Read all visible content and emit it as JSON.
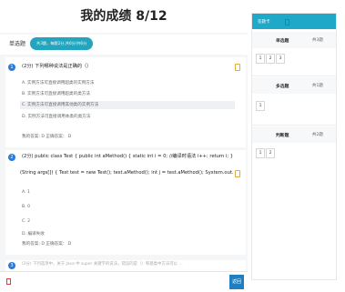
{
  "page": {
    "title": "我的成绩 8/12"
  },
  "tabs": {
    "single": "单选题",
    "pill": "共3题，每题2分,共6分/共6分"
  },
  "questions": [
    {
      "num": "1",
      "stem": "(2分)  下列哪种说法是正确的（）",
      "options": [
        "A. 实例方法可直接调用超类的实例方法",
        "B. 实例方法可直接调用超类的类方法",
        "C. 实例方法可直接调用其他类的实例方法",
        "D. 实例方法可直接调用本类的类方法"
      ],
      "answer": "我的答案: D  正确答案： D"
    },
    {
      "num": "2",
      "stem_line1": "(2分)  public class Test { public int aMethod() { static int i = 0; //编译时语法 i++; return i; } public static void main",
      "stem_line2": "(String args[]) { Test test = new Test(); test.aMethod(); int j = test.aMethod(); System.out.println(j); } }",
      "options": [
        "A. 1",
        "B. 0",
        "C. 2",
        "D. 编译失败"
      ],
      "answer": "我的答案: D  正确答案： D"
    },
    {
      "num": "3",
      "stem_partial": "(2分)  下列选项中，关于 Java 中 super 关键字的说法，错误的是（）和基类中方法可以 …"
    }
  ],
  "footer": {
    "back_label": "返回"
  },
  "sidebar": {
    "card_label": "答题卡",
    "sections": [
      {
        "name": "单选题",
        "count": "共3题",
        "numbers": [
          "1",
          "2",
          "3"
        ]
      },
      {
        "name": "多选题",
        "count": "共1题",
        "numbers": [
          "1"
        ]
      },
      {
        "name": "判断题",
        "count": "共2题",
        "numbers": [
          "1",
          "2"
        ]
      }
    ]
  },
  "colors": {
    "accent": "#23a4bf",
    "number_badge": "#2b7bd8",
    "back_button": "#1f7fc2",
    "flag": "#e6a93a"
  }
}
